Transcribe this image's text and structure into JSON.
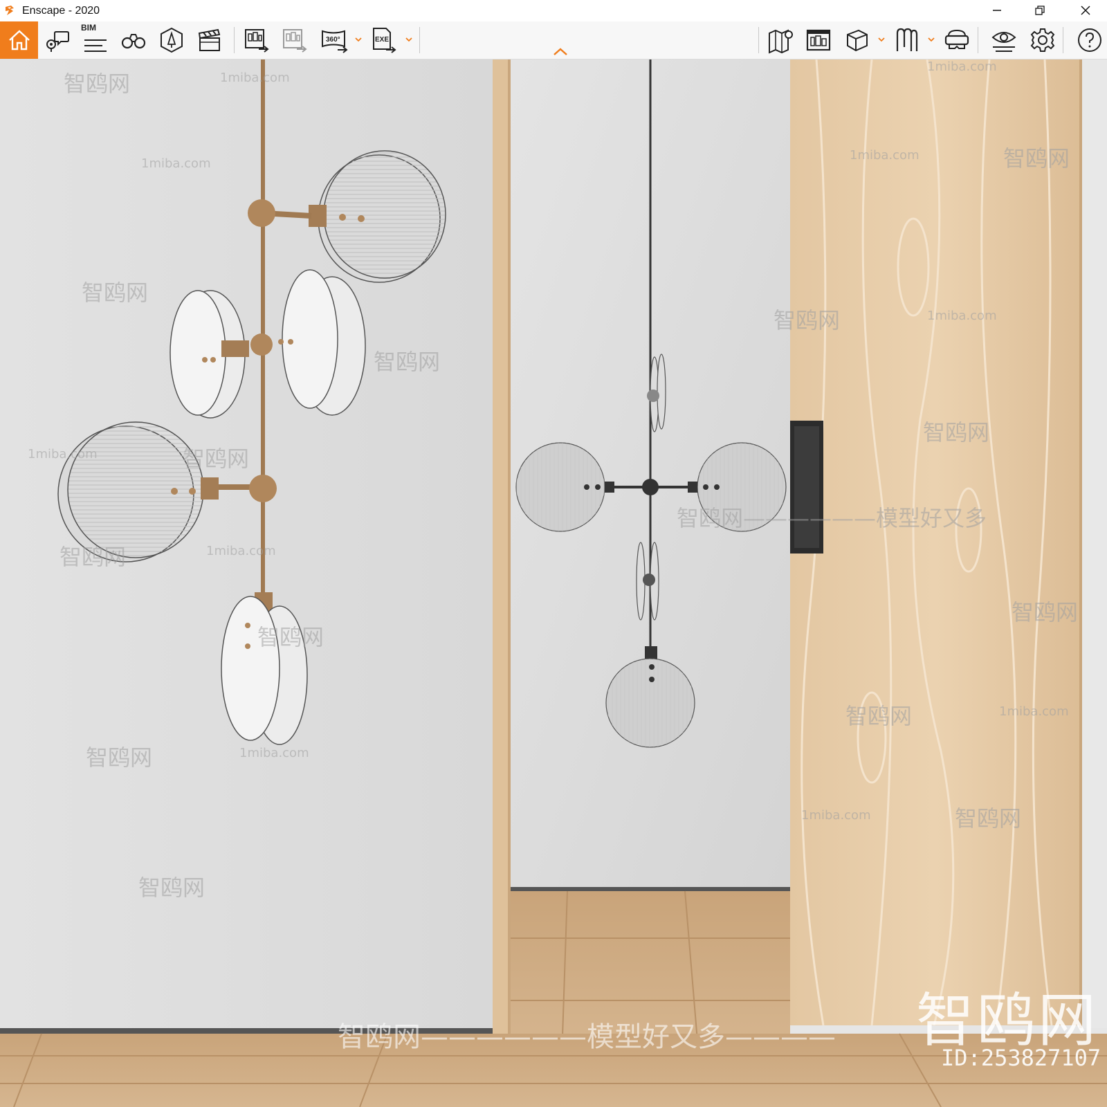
{
  "window": {
    "title": "Enscape - 2020",
    "controls": [
      "minimize",
      "restore",
      "close"
    ]
  },
  "toolbar": {
    "accent_color": "#f07d1c",
    "left_group": [
      {
        "name": "home",
        "icon": "home-icon"
      },
      {
        "name": "views",
        "icon": "location-pin-speech-icon"
      },
      {
        "name": "bim",
        "icon": "bim-list-icon",
        "label": "BIM"
      },
      {
        "name": "binoculars",
        "icon": "binoculars-icon"
      },
      {
        "name": "asset-library",
        "icon": "asset-library-icon"
      },
      {
        "name": "video-editor",
        "icon": "clapperboard-icon"
      }
    ],
    "export_group": [
      {
        "name": "batch-render",
        "icon": "batch-render-icon"
      },
      {
        "name": "render-export",
        "icon": "render-export-icon"
      },
      {
        "name": "panorama-360",
        "icon": "panorama-360-icon",
        "label": "360°"
      },
      {
        "name": "exe-export",
        "icon": "exe-export-icon",
        "label": "EXE"
      }
    ],
    "right_group": [
      {
        "name": "map",
        "icon": "map-icon"
      },
      {
        "name": "mini-map",
        "icon": "minimap-icon"
      },
      {
        "name": "cube-view",
        "icon": "cube-icon"
      },
      {
        "name": "material-editor",
        "icon": "material-editor-icon"
      },
      {
        "name": "vr-headset",
        "icon": "vr-headset-icon"
      },
      {
        "name": "visual-settings",
        "icon": "eye-settings-icon"
      },
      {
        "name": "settings",
        "icon": "gear-icon"
      },
      {
        "name": "help",
        "icon": "help-icon"
      }
    ],
    "collapse_toggle": "chevron-up-icon"
  },
  "viewport": {
    "watermarks": {
      "site": "1miba.com",
      "brand": "智鸥网",
      "slogan": "智鸥网——————模型好又多————",
      "slogan_right": "智鸥网——————模型好又多",
      "big": "智鸥网",
      "id": "ID:253827107"
    }
  }
}
